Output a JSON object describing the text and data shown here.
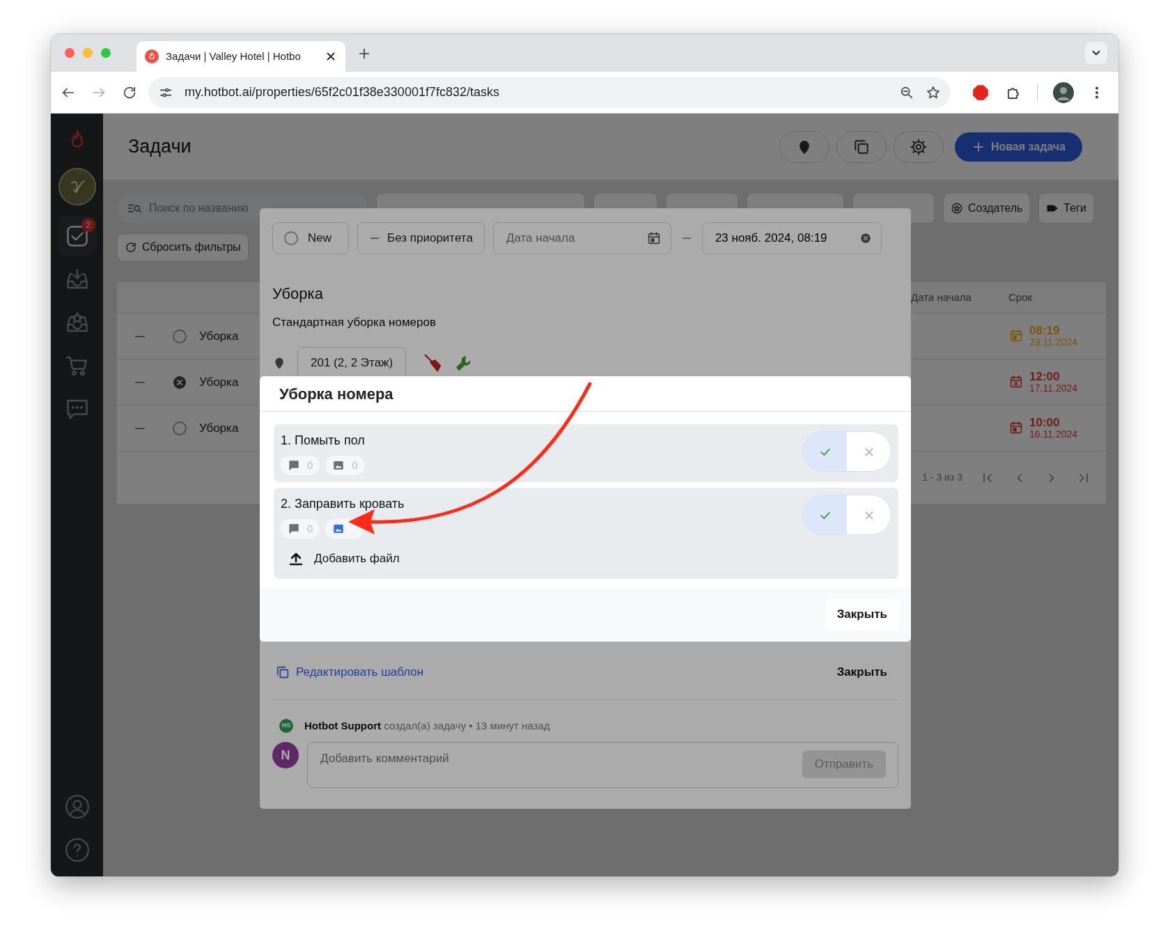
{
  "browser": {
    "tab_title": "Задачи | Valley Hotel | Hotbo",
    "url": "my.hotbot.ai/properties/65f2c01f38e330001f7fc832/tasks"
  },
  "sidebar": {
    "items": [
      {
        "selected": true,
        "badge": "2"
      },
      {
        "selected": false
      },
      {
        "selected": false
      },
      {
        "selected": false
      },
      {
        "selected": false
      }
    ]
  },
  "page": {
    "title": "Задачи",
    "new_task_button": "Новая задача",
    "search": {
      "placeholder": "Поиск по названию"
    },
    "filters": [
      {
        "kind": "icon",
        "label": "Создатель"
      },
      {
        "kind": "icon",
        "label": "Теги"
      }
    ],
    "reset_filters": "Сбросить фильтры",
    "table": {
      "columns": [
        "Дата начала",
        "Срок"
      ],
      "rows": [
        {
          "cancelled": false,
          "title": "Уборка",
          "due_time": "08:19",
          "due_date": "23.11.2024",
          "color": "#7a560c"
        },
        {
          "cancelled": true,
          "title": "Уборка",
          "due_time": "12:00",
          "due_date": "17.11.2024",
          "color": "#70201a"
        },
        {
          "cancelled": false,
          "title": "Уборка",
          "due_time": "10:00",
          "due_date": "16.11.2024",
          "color": "#70201a"
        }
      ]
    },
    "pagination": "1 - 3 из 3"
  },
  "task_modal": {
    "status": "New",
    "priority": "Без приоритета",
    "start_date": {
      "placeholder": "Дата начала"
    },
    "end_date": {
      "value": "23 нояб. 2024, 08:19"
    },
    "title": "Уборка",
    "description": "Стандартная уборка номеров",
    "location": "201 (2, 2 Этаж)",
    "edit_template": "Редактировать шаблон",
    "close": "Закрыть",
    "activity": {
      "avatar": "HS",
      "author": "Hotbot Support",
      "text": "создал(а) задачу • 13 минут назад"
    },
    "comment": {
      "avatar": "N",
      "placeholder": "Добавить комментарий",
      "send": "Отправить",
      "send_disabled": true
    }
  },
  "checklist_modal": {
    "title": "Уборка номера",
    "items": [
      {
        "label": "1. Помыть пол",
        "comment_count": "0",
        "photo_count": "0",
        "has_photos": false,
        "checked": true
      },
      {
        "label": "2. Заправить кровать",
        "comment_count": "0",
        "has_photos": true,
        "checked": true,
        "add_file": "Добавить файл"
      }
    ],
    "close": "Закрыть"
  }
}
